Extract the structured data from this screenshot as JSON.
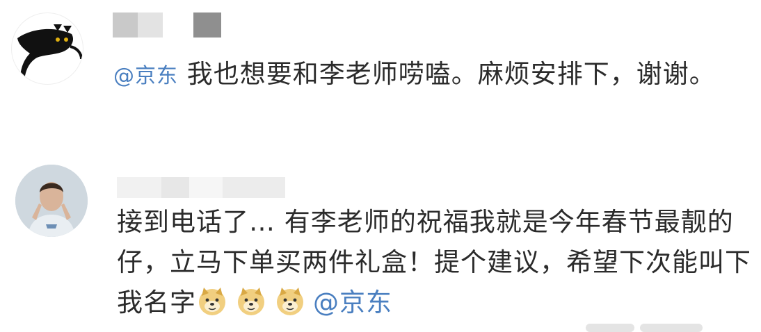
{
  "comments": [
    {
      "mention": "@京东",
      "text": " 我也想要和李老师唠嗑。麻烦安排下，谢谢。"
    },
    {
      "text": "接到电话了… 有李老师的祝福我就是今年春节最靓的仔，立马下单买两件礼盒！提个建议，希望下次能叫下我名字",
      "mention": "@京东",
      "emojis": [
        "doge-icon",
        "doge-icon",
        "doge-icon"
      ]
    }
  ]
}
